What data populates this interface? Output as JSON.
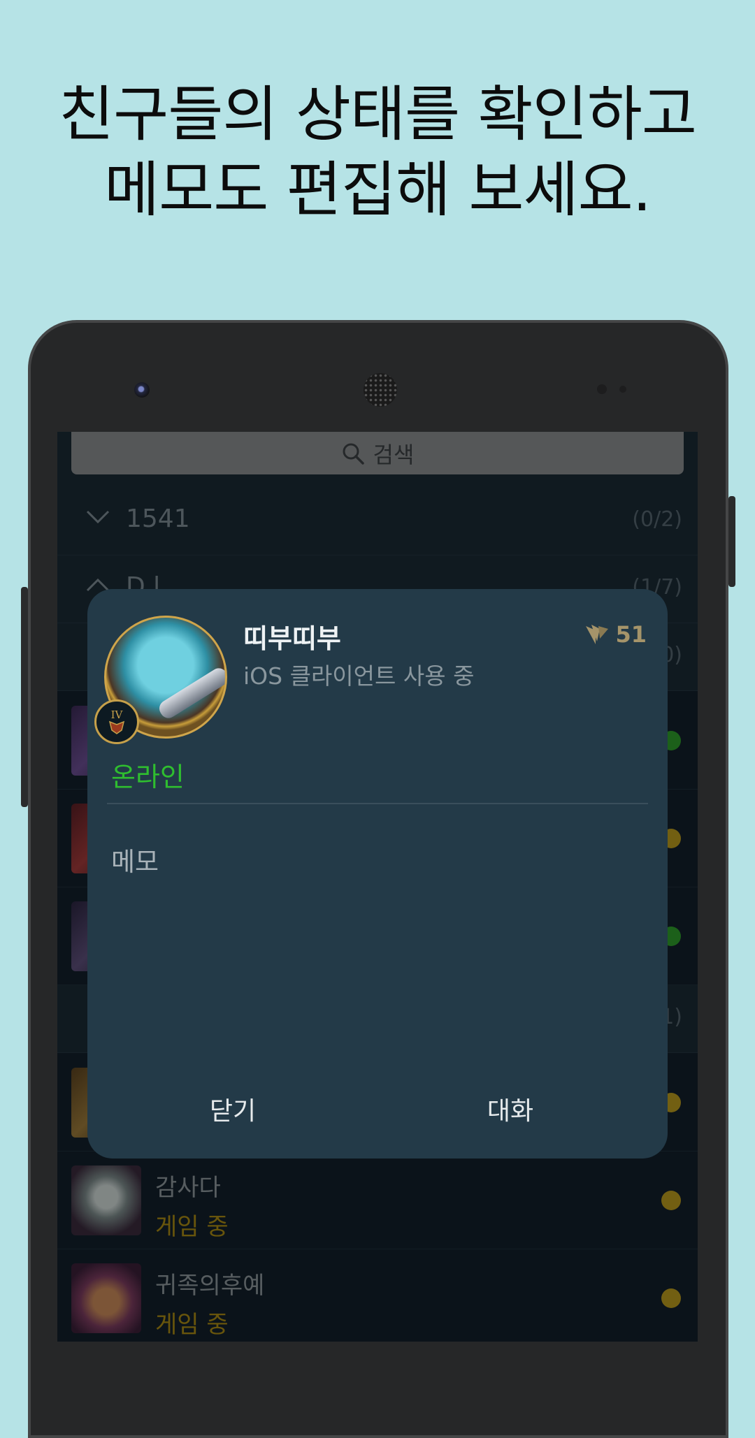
{
  "headline": {
    "line1": "친구들의 상태를 확인하고",
    "line2": "메모도 편집해 보세요."
  },
  "search": {
    "placeholder": "검색",
    "icon": "search-icon"
  },
  "groups": [
    {
      "name": "1541",
      "count": "(0/2)",
      "expanded": true
    },
    {
      "name": "D.l",
      "count": "(1/7)",
      "expanded": false
    },
    {
      "name": "",
      "count": "(0)",
      "expanded": true
    },
    {
      "name": "",
      "count": "(1)",
      "expanded": true
    }
  ],
  "friends_hidden": [
    {
      "status_color": "#2e9b2b"
    },
    {
      "status_color": "#b89a1e"
    },
    {
      "status_color": "#2e9b2b"
    },
    {
      "status_color": "#b89a1e"
    }
  ],
  "friends": [
    {
      "name": "감사다",
      "status": "게임 중",
      "status_color": "#b89a1e"
    },
    {
      "name": "귀족의후예",
      "status": "게임 중",
      "status_color": "#b89a1e"
    }
  ],
  "modal": {
    "name": "띠부띠부",
    "client": "iOS 클라이언트 사용 중",
    "level": "51",
    "rank_tier": "IV",
    "presence": "온라인",
    "memo_label": "메모",
    "close_label": "닫기",
    "chat_label": "대화"
  },
  "colors": {
    "background": "#b6e3e6",
    "modal": "#233a48",
    "online": "#2fbe2f",
    "ingame": "#a88a14"
  }
}
